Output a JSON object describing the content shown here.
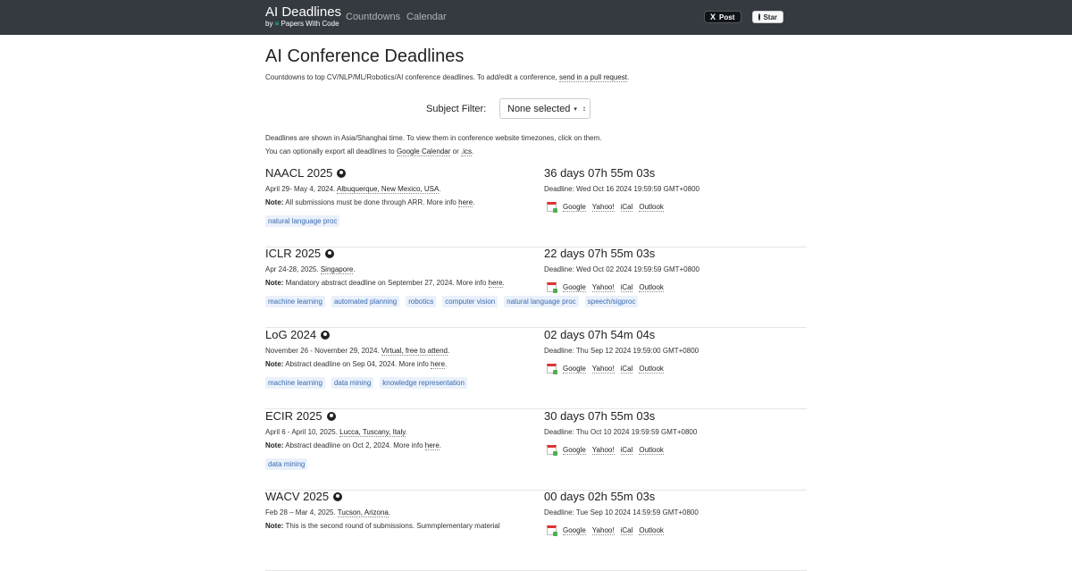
{
  "nav": {
    "brand_title": "AI Deadlines",
    "brand_by": "by",
    "brand_pwc": "≡",
    "brand_sub": "Papers With Code",
    "countdowns": "Countdowns",
    "calendar": "Calendar",
    "x_post": "Post",
    "x_glyph": "X",
    "github_star": "Star"
  },
  "page": {
    "title": "AI Conference Deadlines",
    "intro_text": "Countdowns to top CV/NLP/ML/Robotics/AI conference deadlines. To add/edit a conference,",
    "intro_link": "send in a pull request",
    "intro_end": ".",
    "filter_label": "Subject Filter:",
    "filter_value": "None selected",
    "tz_line1": "Deadlines are shown in Asia/Shanghai time. To view them in conference website timezones, click on them.",
    "tz_line2_pre": "You can optionally export all deadlines to",
    "tz_google": "Google Calendar",
    "tz_or": "or",
    "tz_ics": ".ics",
    "tz_end": "."
  },
  "cal_links": {
    "google": "Google",
    "yahoo": "Yahoo!",
    "ical": "iCal",
    "outlook": "Outlook"
  },
  "conferences": [
    {
      "name": "NAACL 2025",
      "dates": "April 29- May 4, 2024.",
      "place": "Albuquerque, New Mexico, USA",
      "place_end": ".",
      "note_label": "Note:",
      "note_text": "All submissions must be done through ARR. More info",
      "note_link": "here",
      "note_end": ".",
      "tags": [
        "natural language proc"
      ],
      "countdown": "36 days 07h 55m 03s",
      "deadline": "Deadline: Wed Oct 16 2024 19:59:59 GMT+0800"
    },
    {
      "name": "ICLR 2025",
      "dates": "Apr 24-28, 2025.",
      "place": "Singapore",
      "place_end": ".",
      "note_label": "Note:",
      "note_text": "Mandatory abstract deadline on September 27, 2024. More info",
      "note_link": "here",
      "note_end": ".",
      "tags": [
        "machine learning",
        "automated planning",
        "robotics",
        "computer vision",
        "natural language proc",
        "speech/sigproc"
      ],
      "countdown": "22 days 07h 55m 03s",
      "deadline": "Deadline: Wed Oct 02 2024 19:59:59 GMT+0800"
    },
    {
      "name": "LoG 2024",
      "dates": "November 26 - November 29, 2024.",
      "place": "Virtual, free to attend",
      "place_end": ".",
      "note_label": "Note:",
      "note_text": "Abstract deadline on Sep 04, 2024. More info",
      "note_link": "here",
      "note_end": ".",
      "tags": [
        "machine learning",
        "data mining",
        "knowledge representation"
      ],
      "countdown": "02 days 07h 54m 04s",
      "deadline": "Deadline: Thu Sep 12 2024 19:59:00 GMT+0800"
    },
    {
      "name": "ECIR 2025",
      "dates": "April 6 - April 10, 2025.",
      "place": "Lucca, Tuscany, Italy",
      "place_end": ".",
      "note_label": "Note:",
      "note_text": "Abstract deadline on Oct 2, 2024. More info",
      "note_link": "here",
      "note_end": ".",
      "tags": [
        "data mining"
      ],
      "countdown": "30 days 07h 55m 03s",
      "deadline": "Deadline: Thu Oct 10 2024 19:59:59 GMT+0800"
    },
    {
      "name": "WACV 2025",
      "dates": "Feb 28 – Mar 4, 2025.",
      "place": "Tucson, Arizona",
      "place_end": ".",
      "note_label": "Note:",
      "note_text": "This is the second round of submissions. Summplementary material",
      "note_link": "",
      "note_end": "",
      "tags": [],
      "countdown": "00 days 02h 55m 03s",
      "deadline": "Deadline: Tue Sep 10 2024 14:59:59 GMT+0800"
    }
  ]
}
